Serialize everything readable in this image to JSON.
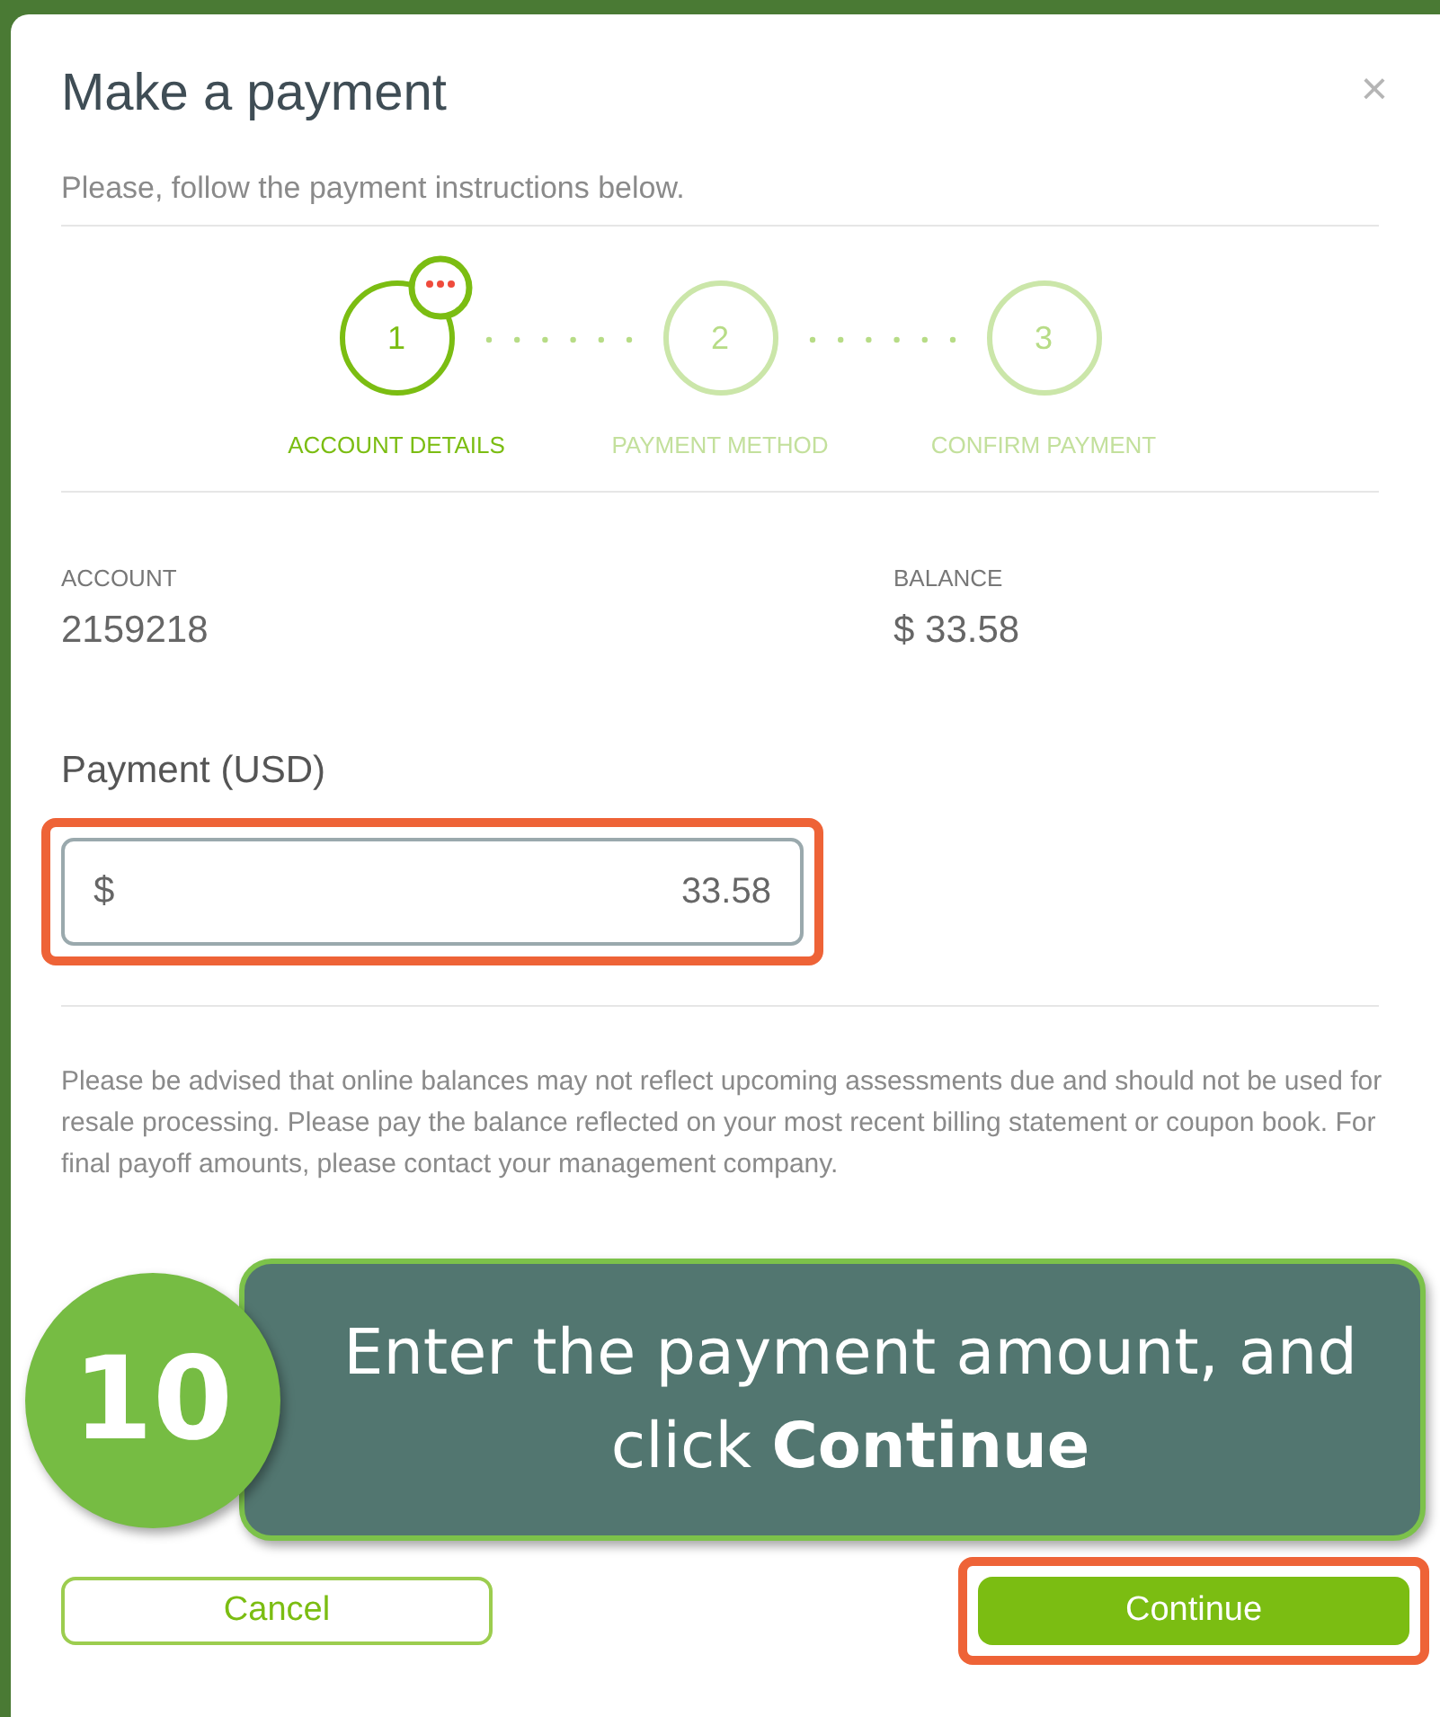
{
  "dialog": {
    "title": "Make a payment",
    "close": "×",
    "subtitle": "Please, follow the payment instructions below."
  },
  "steps": [
    {
      "number": "1",
      "label": "ACCOUNT DETAILS",
      "selected": true,
      "badge": true
    },
    {
      "number": "2",
      "label": "PAYMENT METHOD",
      "selected": false,
      "badge": false
    },
    {
      "number": "3",
      "label": "CONFIRM PAYMENT",
      "selected": false,
      "badge": false
    }
  ],
  "account": {
    "label": "ACCOUNT",
    "value": "2159218"
  },
  "balance": {
    "label": "BALANCE",
    "value": "$ 33.58"
  },
  "payment": {
    "label": "Payment (USD)",
    "currency": "$",
    "value": "33.58",
    "highlighted": true
  },
  "disclaimer": "Please be advised that online balances may not reflect upcoming assessments due and should not be used for resale processing. Please pay the balance reflected on your most recent billing statement or coupon book. For final payoff amounts, please contact your management company.",
  "callout": {
    "number": "10",
    "text": "Enter the payment amount, and click **Continue**"
  },
  "buttons": [
    {
      "label": "Cancel",
      "kind": "secondary",
      "highlighted": false
    },
    {
      "label": "Continue",
      "kind": "primary",
      "highlighted": true
    }
  ]
}
